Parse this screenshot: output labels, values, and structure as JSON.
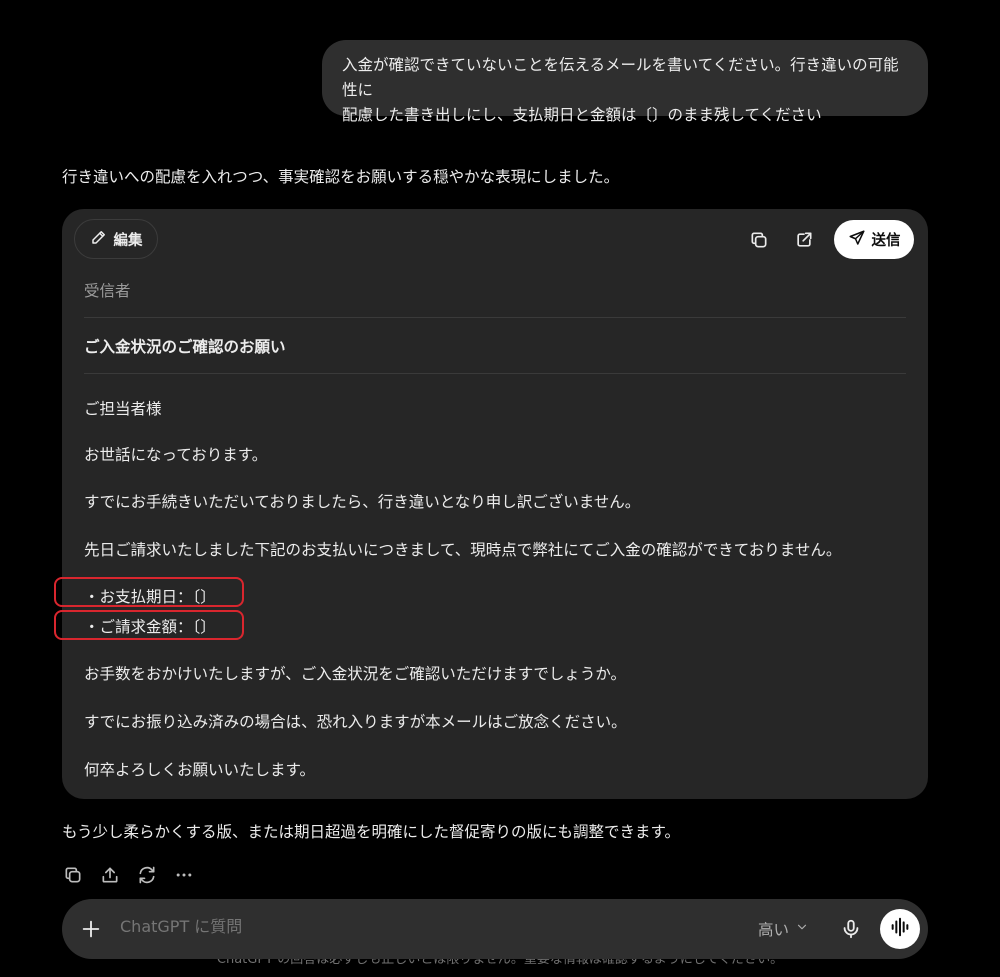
{
  "user_message": {
    "line1": "入金が確認できていないことを伝えるメールを書いてください。行き違いの可能性に",
    "line2": "配慮した書き出しにし、支払期日と金額は〔〕のまま残してください"
  },
  "assistant": {
    "intro": "行き違いへの配慮を入れつつ、事実確認をお願いする穏やかな表現にしました。",
    "outro": "もう少し柔らかくする版、または期日超過を明確にした督促寄りの版にも調整できます。"
  },
  "email": {
    "edit_label": "編集",
    "send_label": "送信",
    "recipient_placeholder": "受信者",
    "subject": "ご入金状況のご確認のお願い",
    "body": [
      "ご担当者様",
      "お世話になっております。",
      "すでにお手続きいただいておりましたら、行き違いとなり申し訳ございません。",
      "先日ご請求いたしました下記のお支払いにつきまして、現時点で弊社にてご入金の確認ができておりません。",
      "・お支払期日：〔〕",
      "・ご請求金額：〔〕",
      "お手数をおかけいたしますが、ご入金状況をご確認いただけますでしょうか。",
      "すでにお振り込み済みの場合は、恐れ入りますが本メールはご放念ください。",
      "何卒よろしくお願いいたします。"
    ]
  },
  "composer": {
    "placeholder": "ChatGPT に質問",
    "model_label": "高い"
  },
  "disclaimer": "ChatGPT の回答は必ずしも正しいとは限りません。重要な情報は確認するようにしてください。",
  "icons": {
    "edit": "pencil-icon",
    "copy": "copy-icon",
    "open": "external-link-icon",
    "send": "paper-plane-icon",
    "share": "share-icon",
    "regenerate": "refresh-icon",
    "more": "more-icon",
    "plus": "plus-icon",
    "chevron": "chevron-down-icon",
    "mic": "microphone-icon",
    "voice": "voice-waveform-icon"
  },
  "colors": {
    "background": "#000000",
    "bubble": "#2f2f2f",
    "card": "#262626",
    "highlight": "#d9262e"
  }
}
